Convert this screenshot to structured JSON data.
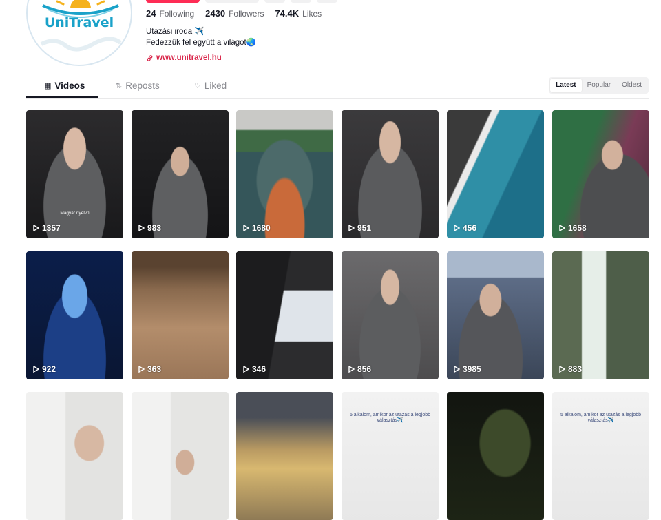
{
  "profile": {
    "logo_text": "UniTravel",
    "stats": [
      {
        "num": "24",
        "label": "Following"
      },
      {
        "num": "2430",
        "label": "Followers"
      },
      {
        "num": "74.4K",
        "label": "Likes"
      }
    ],
    "bio_line1": "Utazási iroda ✈️",
    "bio_line2": "Fedezzük fel együtt a világot🌏",
    "website": "www.unitravel.hu"
  },
  "tabs": [
    {
      "label": "Videos",
      "icon": "grid-icon"
    },
    {
      "label": "Reposts",
      "icon": "repost-icon"
    },
    {
      "label": "Liked",
      "icon": "heart-icon"
    }
  ],
  "sort": {
    "options": [
      "Latest",
      "Popular",
      "Oldest"
    ],
    "selected": "Latest"
  },
  "videos": [
    {
      "plays": "1357",
      "caption": "Magyar nyelvű"
    },
    {
      "plays": "983",
      "caption": ""
    },
    {
      "plays": "1680",
      "caption": ""
    },
    {
      "plays": "951",
      "caption": ""
    },
    {
      "plays": "456",
      "caption": ""
    },
    {
      "plays": "1658",
      "caption": ""
    },
    {
      "plays": "922",
      "caption": ""
    },
    {
      "plays": "363",
      "caption": ""
    },
    {
      "plays": "346",
      "caption": ""
    },
    {
      "plays": "856",
      "caption": ""
    },
    {
      "plays": "3985",
      "caption": ""
    },
    {
      "plays": "883",
      "caption": ""
    },
    {
      "plays": "",
      "caption": ""
    },
    {
      "plays": "",
      "caption": ""
    },
    {
      "plays": "",
      "caption": ""
    },
    {
      "plays": "",
      "caption": "5 alkalom, amikor az utazás a legjobb választás✈️"
    },
    {
      "plays": "",
      "caption": ""
    },
    {
      "plays": "",
      "caption": "5 alkalom, amikor az utazás a legjobb választás✈️"
    }
  ],
  "colors": {
    "accent": "#fe2c55",
    "link": "#d9264a",
    "logo": "#1aa2c9"
  }
}
